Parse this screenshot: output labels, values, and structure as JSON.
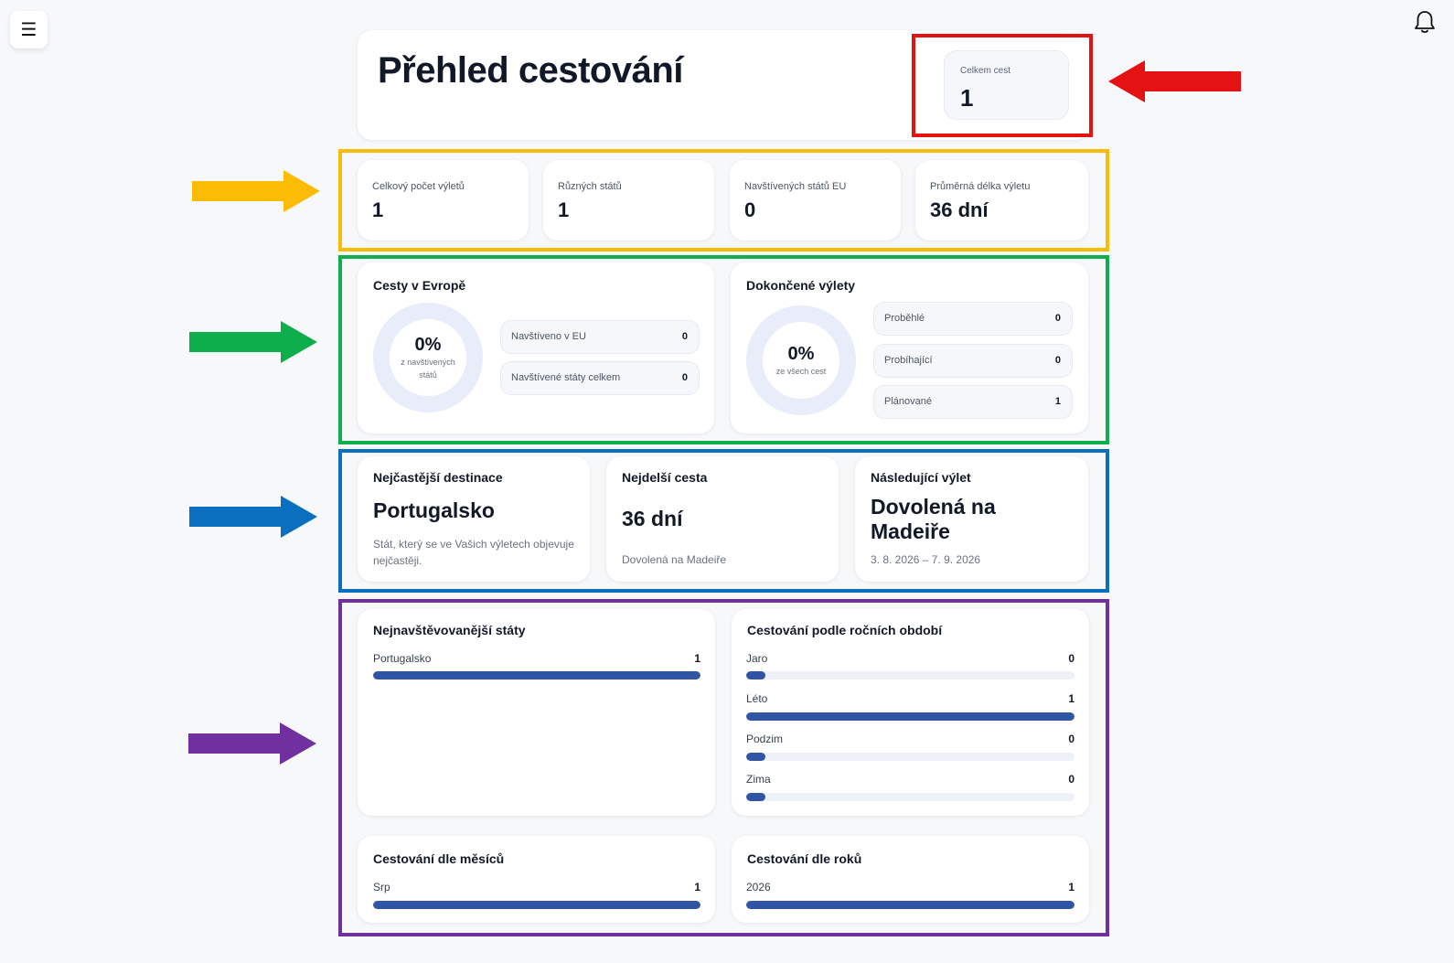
{
  "nav": {
    "menu_icon": "☰"
  },
  "colors": {
    "red": "#e41212",
    "yellow": "#fbbc05",
    "green": "#0fae4c",
    "blue": "#0b6fc0",
    "purple": "#7030a0",
    "bar": "#2f55a4",
    "track": "#eef2f8",
    "donut": "#e9edf9"
  },
  "hero": {
    "title": "Přehled cestování",
    "total_label": "Celkem cest",
    "total_value": "1"
  },
  "stats": [
    {
      "label": "Celkový počet výletů",
      "value": "1"
    },
    {
      "label": "Různých států",
      "value": "1"
    },
    {
      "label": "Navštívených států EU",
      "value": "0"
    },
    {
      "label": "Průměrná délka výletu",
      "value": "36 dní"
    }
  ],
  "europe": {
    "title": "Cesty v Evropě",
    "percent": "0%",
    "percent_value": 0,
    "subtitle": "z navštívených států",
    "rows": [
      {
        "label": "Navštíveno v EU",
        "value": "0"
      },
      {
        "label": "Navštívené státy celkem",
        "value": "0"
      }
    ]
  },
  "completed": {
    "title": "Dokončené výlety",
    "percent": "0%",
    "percent_value": 0,
    "subtitle": "ze všech cest",
    "rows": [
      {
        "label": "Proběhlé",
        "value": "0"
      },
      {
        "label": "Probíhající",
        "value": "0"
      },
      {
        "label": "Plánované",
        "value": "1"
      }
    ]
  },
  "highlights": {
    "destination": {
      "title": "Nejčastější destinace",
      "value": "Portugalsko",
      "desc": "Stát, který se ve Vašich výletech objevuje nejčastěji."
    },
    "longest": {
      "title": "Nejdelší cesta",
      "value": "36 dní",
      "desc": "Dovolená na Madeiře"
    },
    "next": {
      "title": "Následující výlet",
      "value": "Dovolená na Madeiře",
      "desc": "3. 8. 2026 – 7. 9. 2026"
    }
  },
  "top_states": {
    "title": "Nejnavštěvovanější státy",
    "items": [
      {
        "label": "Portugalsko",
        "value": "1",
        "fraction": 1
      }
    ]
  },
  "seasons": {
    "title": "Cestování podle ročních období",
    "items": [
      {
        "label": "Jaro",
        "value": "0",
        "fraction": 0
      },
      {
        "label": "Léto",
        "value": "1",
        "fraction": 1
      },
      {
        "label": "Podzim",
        "value": "0",
        "fraction": 0
      },
      {
        "label": "Zima",
        "value": "0",
        "fraction": 0
      }
    ]
  },
  "months": {
    "title": "Cestování dle měsíců",
    "items": [
      {
        "label": "Srp",
        "value": "1",
        "fraction": 1
      }
    ]
  },
  "years": {
    "title": "Cestování dle roků",
    "items": [
      {
        "label": "2026",
        "value": "1",
        "fraction": 1
      }
    ]
  }
}
